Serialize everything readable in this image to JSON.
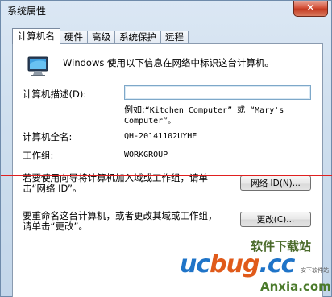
{
  "window": {
    "title": "系统属性",
    "close_label": "✕"
  },
  "tabs": [
    {
      "label": "计算机名",
      "active": true
    },
    {
      "label": "硬件",
      "active": false
    },
    {
      "label": "高级",
      "active": false
    },
    {
      "label": "系统保护",
      "active": false
    },
    {
      "label": "远程",
      "active": false
    }
  ],
  "panel": {
    "intro": "Windows 使用以下信息在网络中标识这台计算机。",
    "description_label": "计算机描述(D):",
    "description_value": "",
    "example_line1_prefix": "例如:",
    "example_line1_mono": "“Kitchen Computer” 或 “Mary's",
    "example_line2_mono": "Computer”。",
    "fullname_label": "计算机全名:",
    "fullname_value": "QH-20141102UYHE",
    "workgroup_label": "工作组:",
    "workgroup_value": "WORKGROUP",
    "network_id_text_line1": "若要使用向导将计算机加入域或工作组，请单",
    "network_id_text_line2": "击“网络 ID”。",
    "network_id_button": "网络 ID(N)...",
    "rename_text_line1": "要重命名这台计算机，或者更改其域或工作组，",
    "rename_text_line2": "请单击“更改”。",
    "change_button": "更改(C)..."
  },
  "watermark": {
    "top": "软件下载站",
    "main_u": "u",
    "main_c": "c",
    "main_b": "bug",
    "main_rest": ".cc",
    "small": "安下软件站",
    "bottom": "Anxia.com"
  },
  "colors": {
    "annotation_line": "#e02020",
    "watermark_blue": "#1f74c8",
    "watermark_orange": "#e05a1a"
  }
}
